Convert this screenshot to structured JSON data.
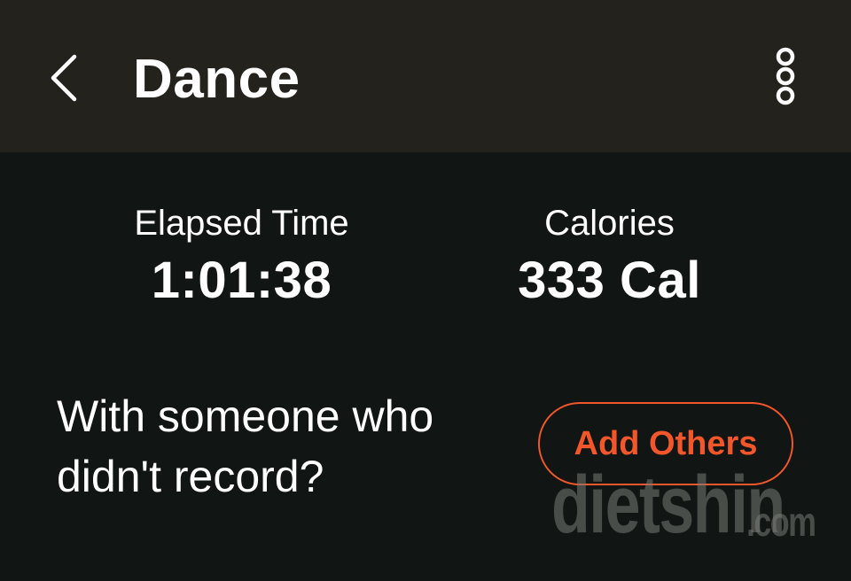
{
  "header": {
    "title": "Dance",
    "back_icon": "chevron-left-icon",
    "more_icon": "more-vertical-icon",
    "background": "#23221d"
  },
  "stats": {
    "elapsed": {
      "label": "Elapsed Time",
      "value": "1:01:38"
    },
    "calories": {
      "label": "Calories",
      "value": "333 Cal"
    }
  },
  "companion": {
    "prompt_line1": "With someone who",
    "prompt_line2": "didn't record?",
    "button_label": "Add Others",
    "accent": "#f2572b"
  },
  "watermark": {
    "brand": "dietshin",
    "suffix": ".com"
  },
  "colors": {
    "background": "#111513",
    "text": "#ffffff"
  }
}
